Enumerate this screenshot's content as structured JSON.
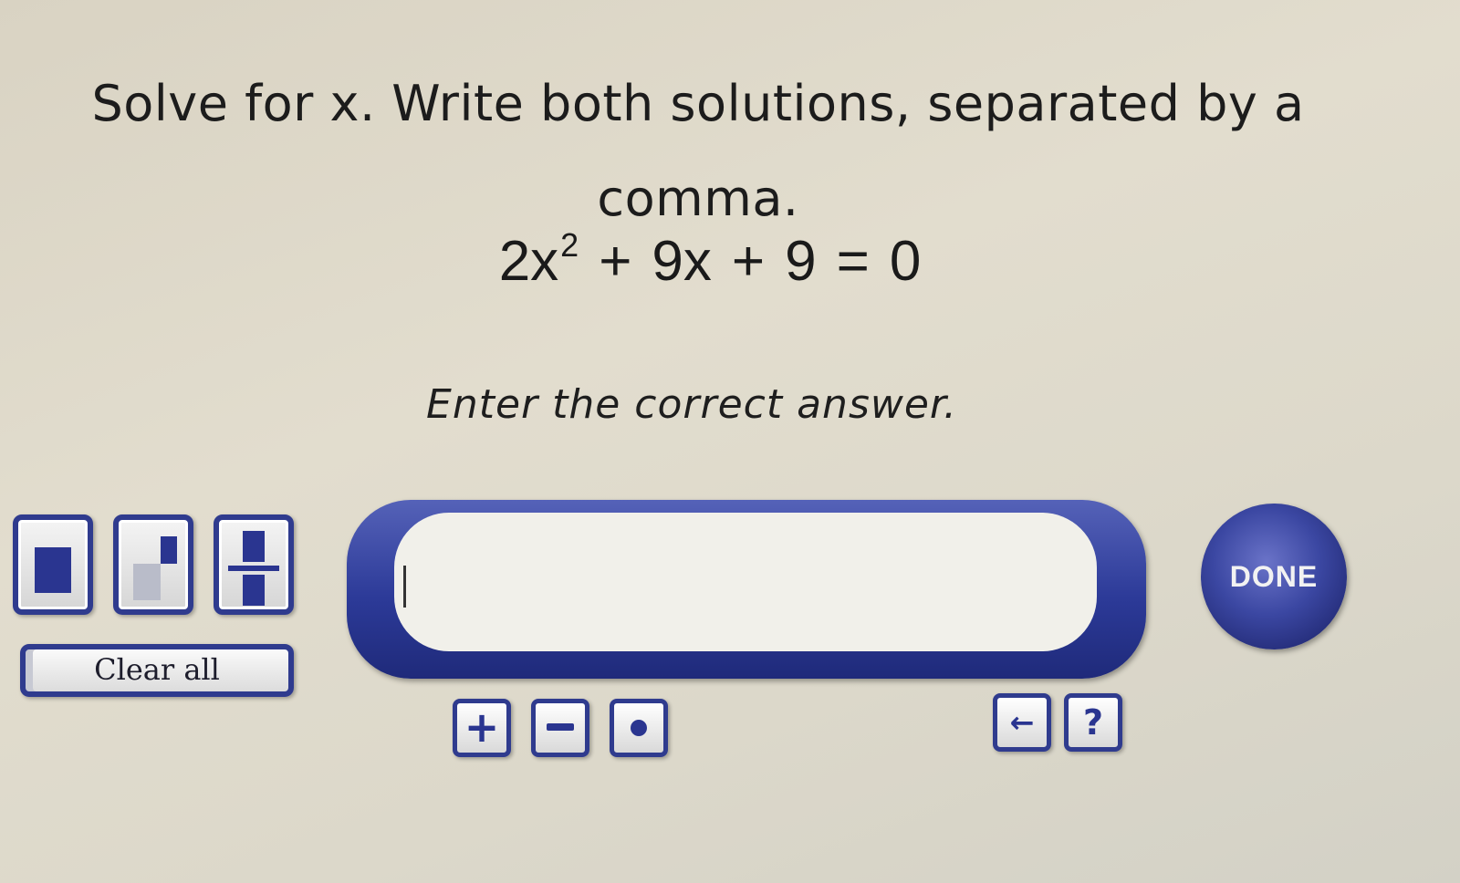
{
  "question": {
    "line1": "Solve for x. Write both solutions, separated by a",
    "line2": "comma."
  },
  "equation": {
    "coef": "2x",
    "exponent": "2",
    "plus1": "+",
    "term2": "9x",
    "plus2": "+",
    "term3": "9",
    "equals": "=",
    "rhs": "0"
  },
  "instruction": "Enter the correct answer.",
  "templates": {
    "clear_all_label": "Clear all"
  },
  "answer": {
    "value": "",
    "placeholder": ""
  },
  "done_label": "DONE",
  "keys": {
    "plus": "+",
    "back": "←",
    "help": "?"
  },
  "colors": {
    "accent": "#2f3b8e",
    "background": "#ddd8c9"
  }
}
